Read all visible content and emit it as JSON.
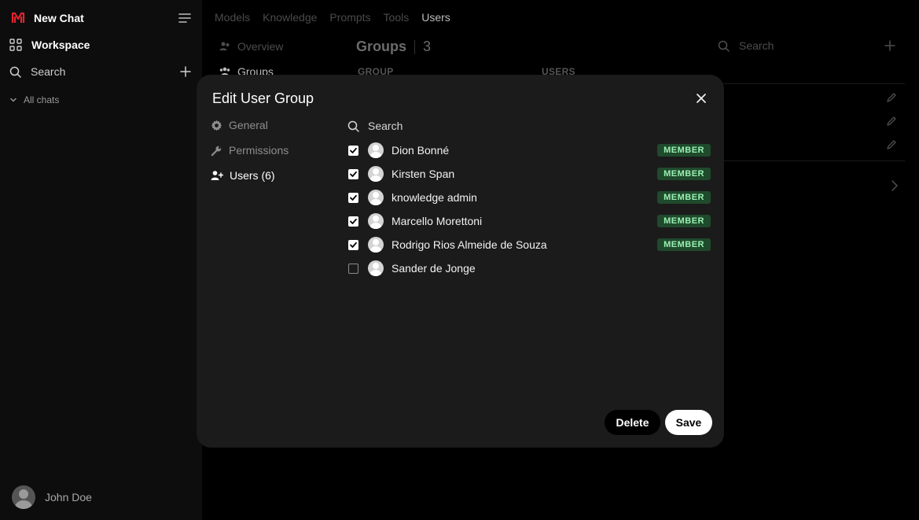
{
  "sidebar": {
    "new_chat": "New Chat",
    "workspace": "Workspace",
    "search": "Search",
    "all_chats": "All chats",
    "user_name": "John Doe"
  },
  "topnav": [
    "Models",
    "Knowledge",
    "Prompts",
    "Tools",
    "Users"
  ],
  "subnav": {
    "overview": "Overview",
    "groups": "Groups"
  },
  "groups_header": {
    "title": "Groups",
    "count": "3",
    "col_group": "GROUP",
    "col_users": "USERS",
    "search_placeholder": "Search"
  },
  "modal": {
    "title": "Edit User Group",
    "tabs": {
      "general": "General",
      "permissions": "Permissions",
      "users": "Users (6)"
    },
    "search_placeholder": "Search",
    "users": [
      {
        "name": "Dion Bonné",
        "checked": true,
        "badge": "MEMBER"
      },
      {
        "name": "Kirsten Span",
        "checked": true,
        "badge": "MEMBER"
      },
      {
        "name": "knowledge admin",
        "checked": true,
        "badge": "MEMBER"
      },
      {
        "name": "Marcello Morettoni",
        "checked": true,
        "badge": "MEMBER"
      },
      {
        "name": "Rodrigo Rios Almeide de Souza",
        "checked": true,
        "badge": "MEMBER"
      },
      {
        "name": "Sander de Jonge",
        "checked": false,
        "badge": ""
      }
    ],
    "delete_label": "Delete",
    "save_label": "Save"
  },
  "colors": {
    "badge_bg": "#1f4a2c",
    "badge_text": "#9af0b2",
    "logo_red": "#e0242f"
  }
}
